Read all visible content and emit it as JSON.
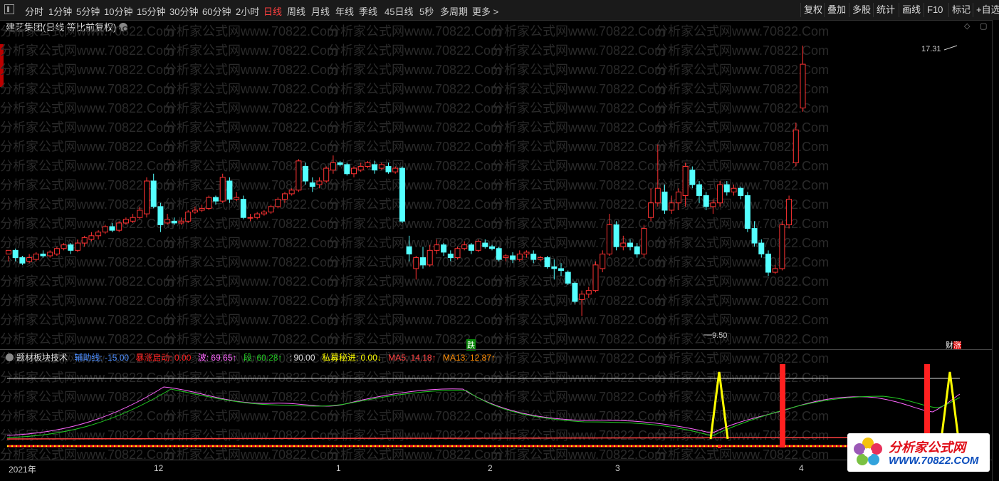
{
  "toolbar": {
    "periods": [
      "分时",
      "1分钟",
      "5分钟",
      "10分钟",
      "15分钟",
      "30分钟",
      "60分钟",
      "2小时",
      "日线",
      "周线",
      "月线",
      "年线",
      "季线",
      "45日线",
      "5秒",
      "多周期",
      "更多 >"
    ],
    "active": "日线",
    "right_tools": [
      "复权",
      "叠加",
      "多股",
      "统计",
      "画线",
      "F10",
      "标记",
      "+自选"
    ]
  },
  "title": "建艺集团(日线 等比前复权)",
  "watermark": "分析家公式网www.70822.Com",
  "price_labels": {
    "high": "17.31",
    "low": "9.50"
  },
  "markers": {
    "fall": "跌",
    "finance": "财",
    "rise": "涨"
  },
  "indicator": {
    "name": "题材板块技术",
    "items": [
      {
        "label": "辅助线:",
        "value": "-15.00",
        "color": "#4a8cff"
      },
      {
        "label": "暴涨启动:",
        "value": "0.00",
        "color": "#ff2020"
      },
      {
        "label": "波:",
        "value": "69.65↑",
        "color": "#ff66ff"
      },
      {
        "label": "段:",
        "value": "60.28↑",
        "color": "#22cc22"
      },
      {
        "label": ":",
        "value": "90.00",
        "color": "#dddddd"
      },
      {
        "label": "私募秘进:",
        "value": "0.00↓",
        "color": "#ffff00"
      },
      {
        "label": "MA5:",
        "value": "14.18↑",
        "color": "#ff4040"
      },
      {
        "label": "MA13:",
        "value": "12.87↑",
        "color": "#ff8c00"
      }
    ]
  },
  "time_axis": [
    "2021年",
    "12",
    "1",
    "2",
    "3",
    "4"
  ],
  "logo": {
    "line1": "分析家公式网",
    "line2": "WWW.70822.COM"
  },
  "colors": {
    "up": "#ff3232",
    "down": "#54ffff",
    "background": "#000000"
  }
}
